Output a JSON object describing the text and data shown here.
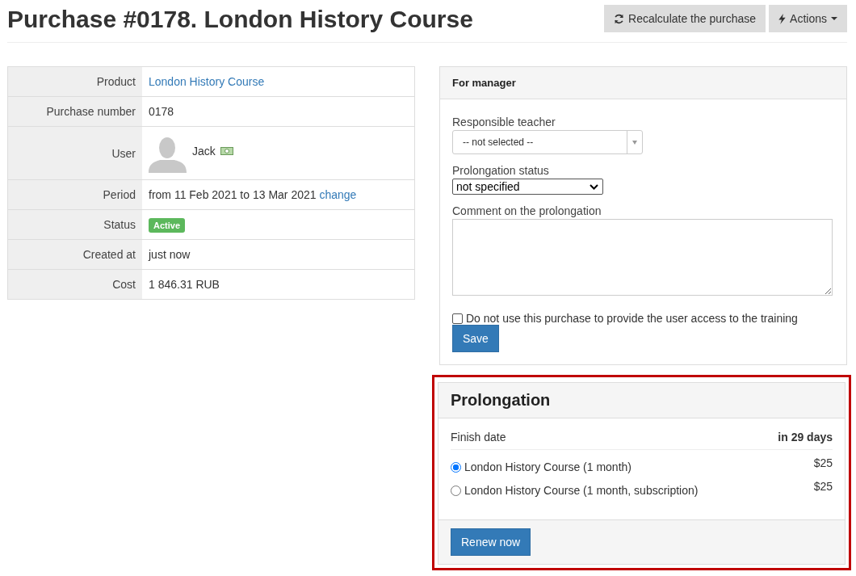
{
  "title": "Purchase #0178. London History Course",
  "toolbar": [
    {
      "kind": "recalculate",
      "label": "Recalculate the purchase"
    },
    {
      "kind": "dropdown",
      "label": "Actions"
    }
  ],
  "details": [
    {
      "label": "Product",
      "kind": "link",
      "value": "London History Course"
    },
    {
      "label": "Purchase number",
      "kind": "text",
      "value": "0178"
    },
    {
      "label": "User",
      "kind": "user",
      "value": "Jack"
    },
    {
      "label": "Period",
      "kind": "period",
      "value": "from 11 Feb 2021 to 13 Mar 2021",
      "link": "change"
    },
    {
      "label": "Status",
      "kind": "badge",
      "value": "Active"
    },
    {
      "label": "Created at",
      "kind": "text",
      "value": "just now"
    },
    {
      "label": "Cost",
      "kind": "text",
      "value": "1 846.31 RUB"
    }
  ],
  "manager": {
    "heading": "For manager",
    "teacher_label": "Responsible teacher",
    "teacher_value": "-- not selected --",
    "status_label": "Prolongation status",
    "status_value": "not specified",
    "comment_label": "Comment on the prolongation",
    "checkbox_label": "Do not use this purchase to provide the user access to the training",
    "checkbox_checked": false,
    "save": "Save"
  },
  "prolongation": {
    "heading": "Prolongation",
    "highlighted": true,
    "finish_label": "Finish date",
    "finish_value": "in 29 days",
    "options": [
      {
        "label": "London History Course (1 month)",
        "price": "$25",
        "selected": true
      },
      {
        "label": "London History Course (1 month, subscription)",
        "price": "$25",
        "selected": false
      }
    ],
    "renew": "Renew now"
  }
}
